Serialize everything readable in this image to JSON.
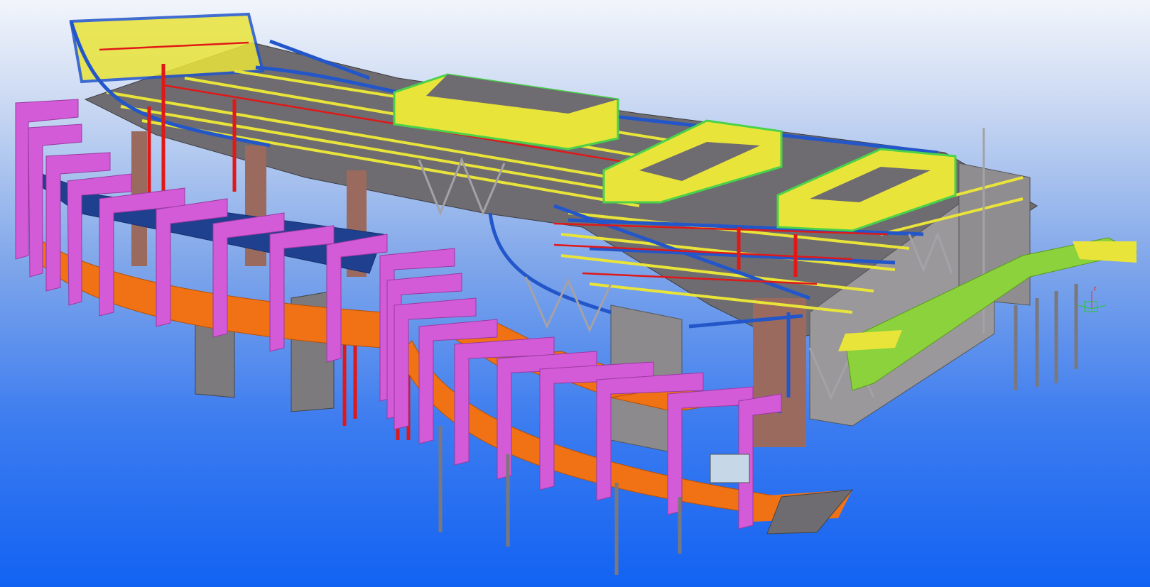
{
  "viewport": {
    "background_top": "#f2f5fb",
    "background_bottom": "#1262f2"
  },
  "model": {
    "colors": {
      "roof_beam": "#e9e43a",
      "main_beam": "#2356c9",
      "column_red": "#e01818",
      "canopy_magenta": "#d35bd8",
      "deck_orange": "#f07214",
      "wall_gray": "#8c8a8c",
      "parapet_green": "#4ad24a",
      "stair_green": "#8cd23c",
      "blue_deck": "#1f3f8f",
      "brick": "#9a6a5e"
    }
  },
  "axis_gizmo": {
    "z_label": "z",
    "x_label": "x",
    "y_label": "y",
    "z_color": "#ff2a2a",
    "x_color": "#28c828",
    "y_color": "#28c828"
  }
}
